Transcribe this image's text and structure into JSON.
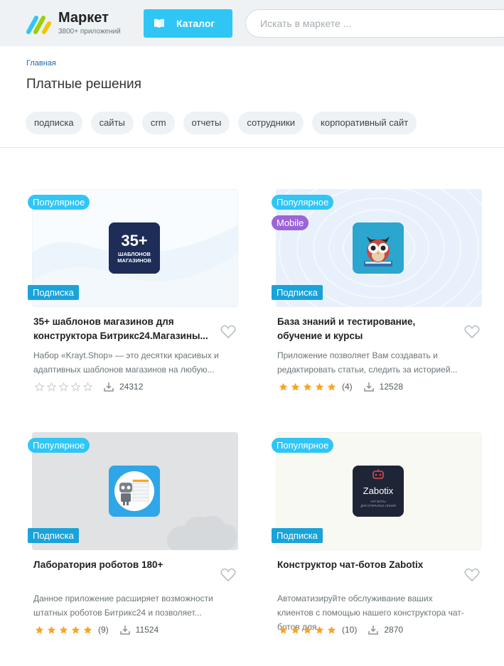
{
  "header": {
    "logo_title": "Маркет",
    "logo_subtitle": "3800+ приложений",
    "catalog_label": "Каталог",
    "search_placeholder": "Искать в маркете ..."
  },
  "breadcrumb": "Главная",
  "page_title": "Платные решения",
  "tags": [
    "подписка",
    "сайты",
    "crm",
    "отчеты",
    "сотрудники",
    "корпоративный сайт"
  ],
  "cards": [
    {
      "badge_popular": "Популярное",
      "badge_subscription": "Подписка",
      "title": "35+ шаблонов магазинов для конструктора Битрикс24.Магазины...",
      "description": "Набор «Krayt.Shop» — это десятки красивых и адаптивных шаблонов магазинов на любую...",
      "rating": 0,
      "rating_count": "",
      "downloads": "24312",
      "icon_text_big": "35+",
      "icon_text_small_1": "ШАБЛОНОВ",
      "icon_text_small_2": "МАГАЗИНОВ"
    },
    {
      "badge_popular": "Популярное",
      "badge_mobile": "Mobile",
      "badge_subscription": "Подписка",
      "title": "База знаний и тестирование, обучение и курсы",
      "description": "Приложение позволяет Вам создавать и редактировать статьи, следить за историей...",
      "rating": 5,
      "rating_count": "(4)",
      "downloads": "12528"
    },
    {
      "badge_popular": "Популярное",
      "badge_subscription": "Подписка",
      "title": "Лаборатория роботов 180+",
      "description": "Данное приложение расширяет возможности штатных роботов Битрикс24 и позволяет...",
      "rating": 5,
      "rating_count": "(9)",
      "downloads": "11524"
    },
    {
      "badge_popular": "Популярное",
      "badge_subscription": "Подписка",
      "title": "Конструктор чат-ботов Zabotix",
      "description": "Автоматизируйте обслуживание ваших клиентов с помощью нашего конструктора чат-ботов для...",
      "rating": 5,
      "rating_count": "(10)",
      "downloads": "2870",
      "icon_text": "Zabotix",
      "icon_subtext_1": "ЧАТ-БОТЫ",
      "icon_subtext_2": "ДЛЯ ОТКРЫТЫХ ЛИНИЙ"
    }
  ],
  "colors": {
    "accent": "#2fc6f6",
    "subscription_badge": "#1aa3d9",
    "mobile_badge": "#9b64d8",
    "star": "#f5a623",
    "link": "#2067b0"
  }
}
